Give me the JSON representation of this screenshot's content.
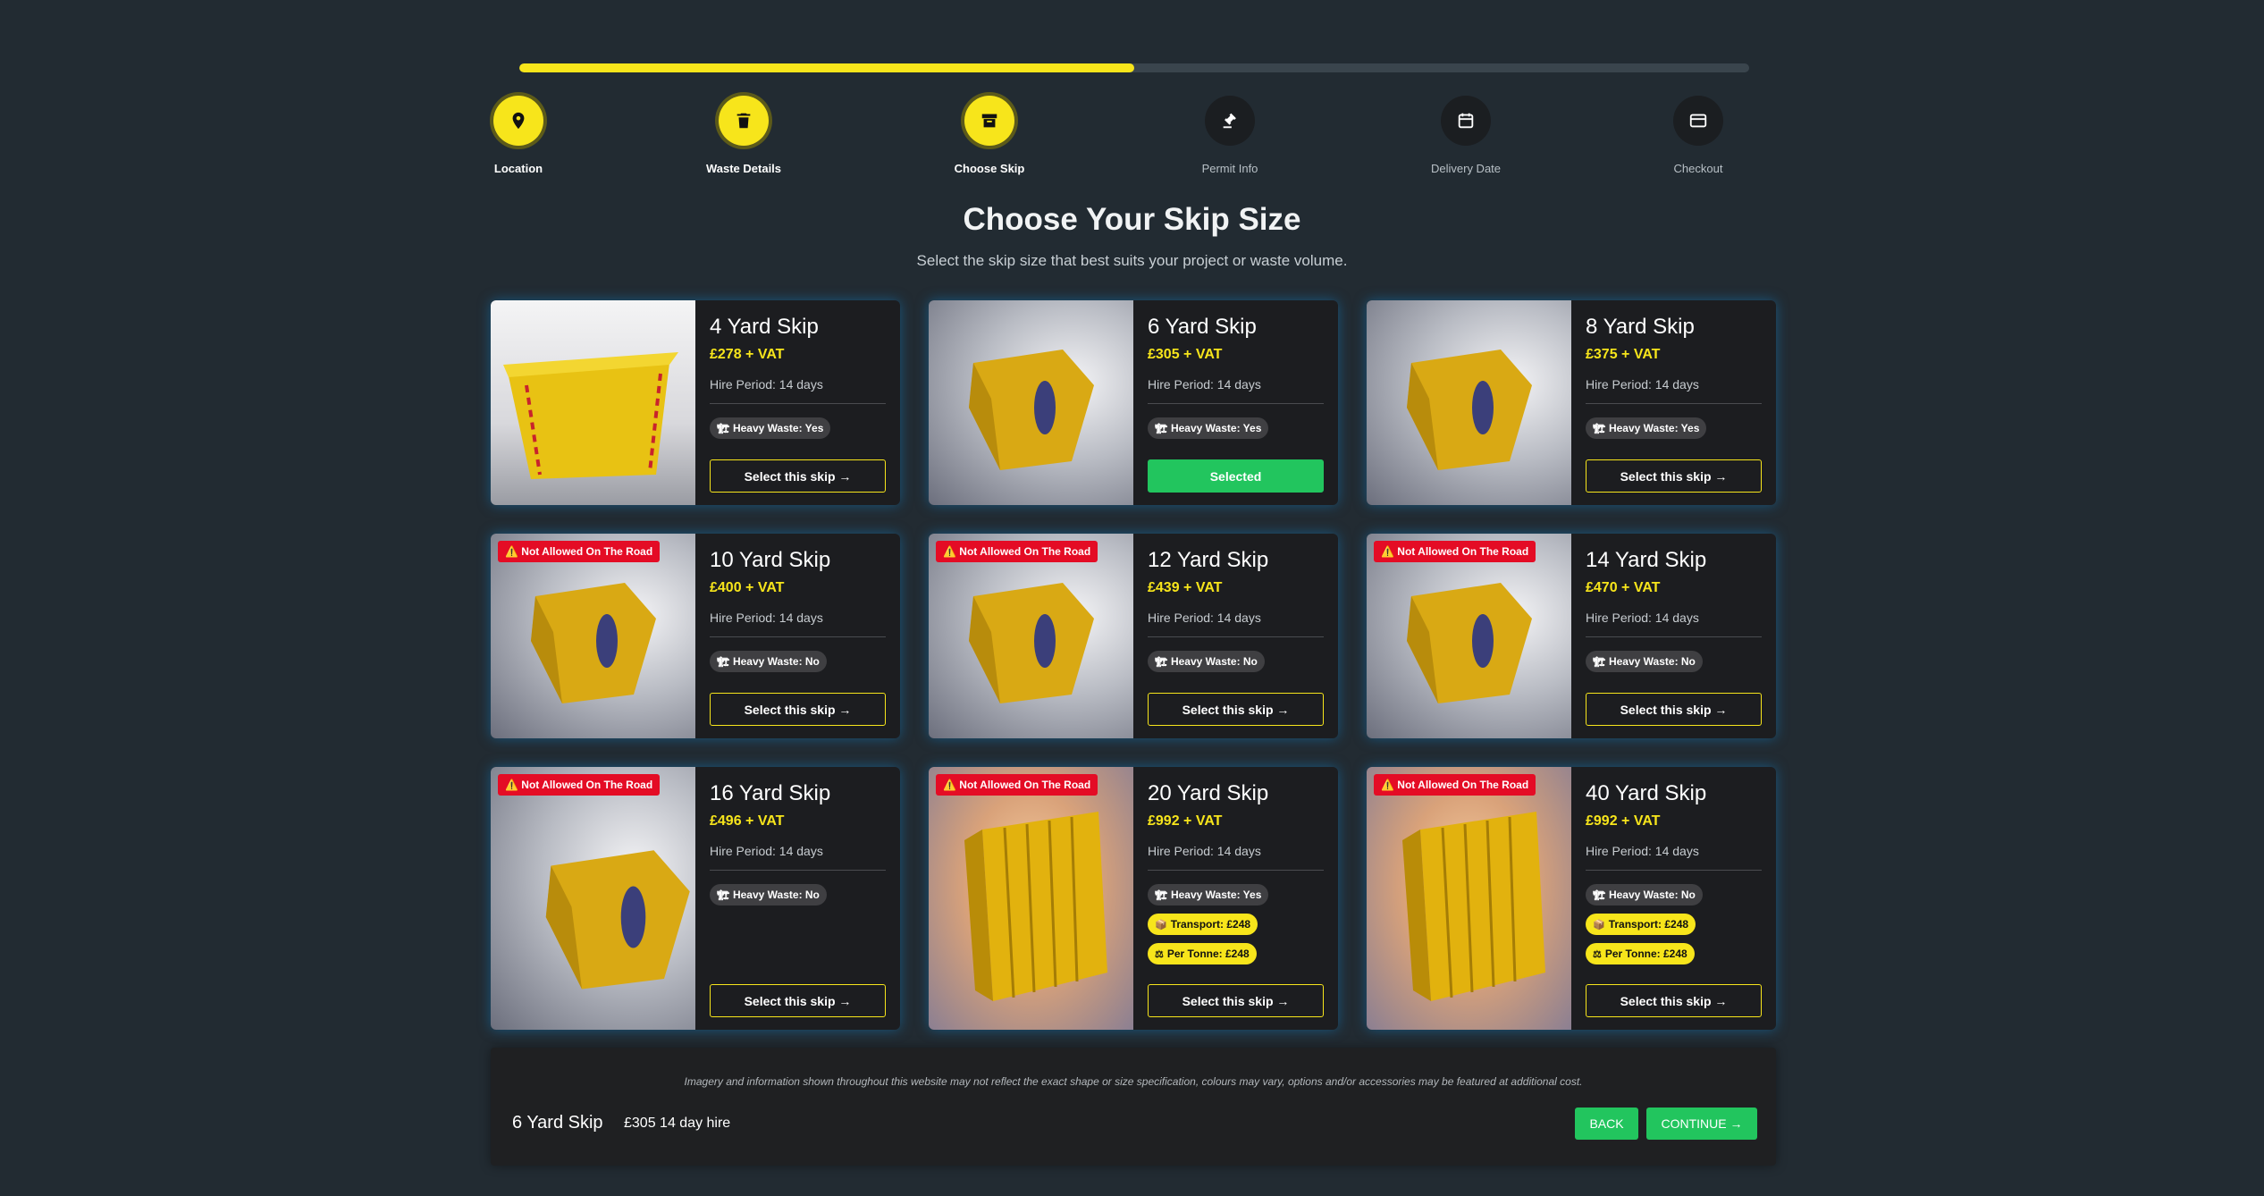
{
  "progress": {
    "value": 0.5
  },
  "steps": [
    {
      "label": "Location",
      "icon": "map-pin-icon",
      "state": "done"
    },
    {
      "label": "Waste Details",
      "icon": "trash-icon",
      "state": "done"
    },
    {
      "label": "Choose Skip",
      "icon": "archive-box-icon",
      "state": "done"
    },
    {
      "label": "Permit Info",
      "icon": "gavel-icon",
      "state": "todo"
    },
    {
      "label": "Delivery Date",
      "icon": "calendar-icon",
      "state": "todo"
    },
    {
      "label": "Checkout",
      "icon": "credit-card-icon",
      "state": "todo"
    }
  ],
  "page": {
    "title": "Choose Your Skip Size",
    "subtitle": "Select the skip size that best suits your project or waste volume."
  },
  "skips": [
    {
      "title": "4 Yard Skip",
      "price": "£278 + VAT",
      "hire": "Hire Period: 14 days",
      "heavy": "Heavy Waste: Yes",
      "road_warning": "",
      "transport": "",
      "per_tonne": "",
      "button": "Select this skip →",
      "selected": false
    },
    {
      "title": "6 Yard Skip",
      "price": "£305 + VAT",
      "hire": "Hire Period: 14 days",
      "heavy": "Heavy Waste: Yes",
      "road_warning": "",
      "transport": "",
      "per_tonne": "",
      "button": "Selected",
      "selected": true
    },
    {
      "title": "8 Yard Skip",
      "price": "£375 + VAT",
      "hire": "Hire Period: 14 days",
      "heavy": "Heavy Waste: Yes",
      "road_warning": "",
      "transport": "",
      "per_tonne": "",
      "button": "Select this skip →",
      "selected": false
    },
    {
      "title": "10 Yard Skip",
      "price": "£400 + VAT",
      "hire": "Hire Period: 14 days",
      "heavy": "Heavy Waste: No",
      "road_warning": "⚠️ Not Allowed On The Road",
      "transport": "",
      "per_tonne": "",
      "button": "Select this skip →",
      "selected": false
    },
    {
      "title": "12 Yard Skip",
      "price": "£439 + VAT",
      "hire": "Hire Period: 14 days",
      "heavy": "Heavy Waste: No",
      "road_warning": "⚠️ Not Allowed On The Road",
      "transport": "",
      "per_tonne": "",
      "button": "Select this skip →",
      "selected": false
    },
    {
      "title": "14 Yard Skip",
      "price": "£470 + VAT",
      "hire": "Hire Period: 14 days",
      "heavy": "Heavy Waste: No",
      "road_warning": "⚠️ Not Allowed On The Road",
      "transport": "",
      "per_tonne": "",
      "button": "Select this skip →",
      "selected": false
    },
    {
      "title": "16 Yard Skip",
      "price": "£496 + VAT",
      "hire": "Hire Period: 14 days",
      "heavy": "Heavy Waste: No",
      "road_warning": "⚠️ Not Allowed On The Road",
      "transport": "",
      "per_tonne": "",
      "button": "Select this skip →",
      "selected": false
    },
    {
      "title": "20 Yard Skip",
      "price": "£992 + VAT",
      "hire": "Hire Period: 14 days",
      "heavy": "Heavy Waste: Yes",
      "road_warning": "⚠️ Not Allowed On The Road",
      "transport": "Transport: £248",
      "per_tonne": "Per Tonne: £248",
      "button": "Select this skip →",
      "selected": false
    },
    {
      "title": "40 Yard Skip",
      "price": "£992 + VAT",
      "hire": "Hire Period: 14 days",
      "heavy": "Heavy Waste: No",
      "road_warning": "⚠️ Not Allowed On The Road",
      "transport": "Transport: £248",
      "per_tonne": "Per Tonne: £248",
      "button": "Select this skip →",
      "selected": false
    }
  ],
  "footer": {
    "disclaimer": "Imagery and information shown throughout this website may not reflect the exact shape or size specification, colours may vary, options and/or accessories may be featured at additional cost.",
    "selected_name": "6 Yard Skip",
    "selected_price": "£305 14 day hire",
    "back_label": "BACK",
    "continue_label": "CONTINUE →"
  },
  "colors": {
    "background": "#222b32",
    "accent_yellow": "#f7e51b",
    "selected_green": "#22c55e",
    "warning_red": "#e40c25",
    "card_bg": "#1c1d20"
  }
}
